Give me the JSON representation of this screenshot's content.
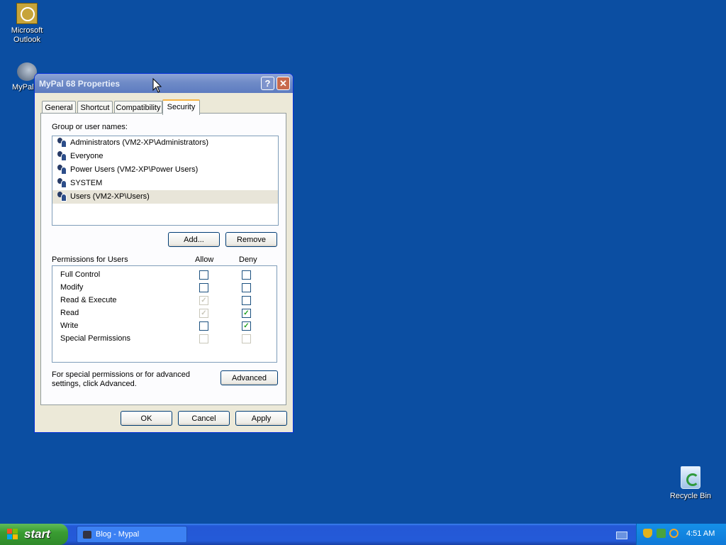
{
  "desktop": {
    "icons": [
      {
        "label": "Microsoft Outlook"
      },
      {
        "label": "MyPal"
      },
      {
        "label": "Recycle Bin"
      }
    ]
  },
  "window": {
    "title": "MyPal 68 Properties",
    "help_label": "?",
    "close_label": "✕",
    "tabs": [
      {
        "label": "General"
      },
      {
        "label": "Shortcut"
      },
      {
        "label": "Compatibility"
      },
      {
        "label": "Security",
        "active": true
      }
    ],
    "security": {
      "group_label": "Group or user names:",
      "users": [
        {
          "label": "Administrators (VM2-XP\\Administrators)"
        },
        {
          "label": "Everyone"
        },
        {
          "label": "Power Users (VM2-XP\\Power Users)"
        },
        {
          "label": "SYSTEM"
        },
        {
          "label": "Users (VM2-XP\\Users)",
          "selected": true
        }
      ],
      "add_label": "Add...",
      "remove_label": "Remove",
      "permissions_label": "Permissions for Users",
      "allow_label": "Allow",
      "deny_label": "Deny",
      "permissions": [
        {
          "name": "Full Control",
          "allow": "",
          "deny": ""
        },
        {
          "name": "Modify",
          "allow": "",
          "deny": ""
        },
        {
          "name": "Read & Execute",
          "allow": "✓",
          "deny": ""
        },
        {
          "name": "Read",
          "allow": "✓",
          "deny": "✓"
        },
        {
          "name": "Write",
          "allow": "",
          "deny": "✓"
        },
        {
          "name": "Special Permissions",
          "allow": "",
          "deny": ""
        }
      ],
      "advanced_text": "For special permissions or for advanced settings, click Advanced.",
      "advanced_label": "Advanced"
    },
    "ok_label": "OK",
    "cancel_label": "Cancel",
    "apply_label": "Apply"
  },
  "taskbar": {
    "start_label": "start",
    "task_label": "Blog - Mypal",
    "clock": "4:51 AM"
  }
}
